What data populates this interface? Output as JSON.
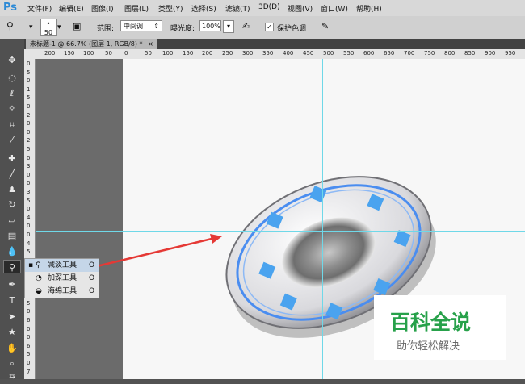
{
  "app": {
    "logo": "Ps"
  },
  "menu": [
    "文件(F)",
    "编辑(E)",
    "图像(I)",
    "图层(L)",
    "类型(Y)",
    "选择(S)",
    "滤镜(T)",
    "3D(D)",
    "视图(V)",
    "窗口(W)",
    "帮助(H)"
  ],
  "options": {
    "brush_size": "50",
    "range_label": "范围:",
    "range_value": "中间调",
    "exposure_label": "曝光度:",
    "exposure_value": "100%",
    "protect_label": "保护色调"
  },
  "document": {
    "tab_title": "未标题-1 @ 66.7% (图层 1, RGB/8) *",
    "close": "×"
  },
  "ruler": {
    "h_ticks": [
      "200",
      "150",
      "100",
      "50",
      "0",
      "50",
      "100",
      "150",
      "200",
      "250",
      "300",
      "350",
      "400",
      "450",
      "500",
      "550",
      "600",
      "650",
      "700",
      "750",
      "800",
      "850",
      "900",
      "950"
    ],
    "v_ticks": [
      "0",
      "5",
      "0",
      "1",
      "5",
      "0",
      "2",
      "0",
      "0",
      "2",
      "5",
      "0",
      "3",
      "0",
      "0",
      "3",
      "5",
      "0",
      "4",
      "0",
      "0",
      "4",
      "5",
      "0",
      "5",
      "0",
      "0",
      "5",
      "5",
      "0",
      "6",
      "0",
      "0",
      "6",
      "5",
      "0",
      "7"
    ]
  },
  "flyout": {
    "items": [
      {
        "label": "减淡工具",
        "key": "O"
      },
      {
        "label": "加深工具",
        "key": "O"
      },
      {
        "label": "海绵工具",
        "key": "O"
      }
    ]
  },
  "watermark": {
    "logo": "百科全说",
    "tagline": "助你轻松解决"
  },
  "colors": {
    "accent": "#2c8ad6",
    "guide": "#6fd8e8",
    "arrow": "#e53935",
    "watermark": "#27a14a",
    "plate_pattern": "#4aa3ef"
  }
}
